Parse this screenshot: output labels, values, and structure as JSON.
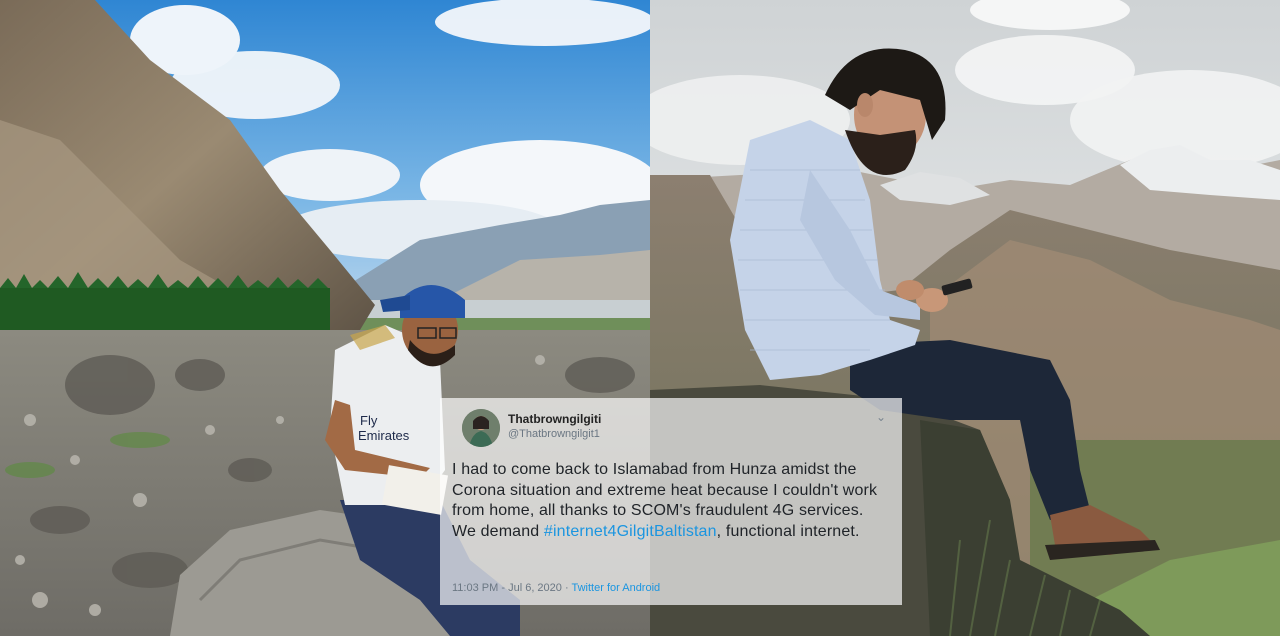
{
  "tweet": {
    "display_name": "Thatbrowngilgiti",
    "handle": "@Thatbrowngilgit1",
    "text_before": "I had to come back to Islamabad from Hunza amidst the Corona situation and extreme heat because I couldn't work from home, all thanks to SCOM's fraudulent 4G services. We demand ",
    "hashtag": "#internet4GilgitBaltistan",
    "text_after": ", functional internet.",
    "time": "11:03 PM",
    "date": "Jul 6, 2020",
    "separator": "·",
    "source": "Twitter for Android",
    "menu_icon": "chevron-down-icon"
  },
  "jersey_text": "Fly\nEmirates",
  "colors": {
    "link": "#1b95e0",
    "sky_left": "#3f8fd6",
    "sky_right": "#d8dcdf",
    "card_bg": "rgba(255,255,255,0.68)"
  }
}
